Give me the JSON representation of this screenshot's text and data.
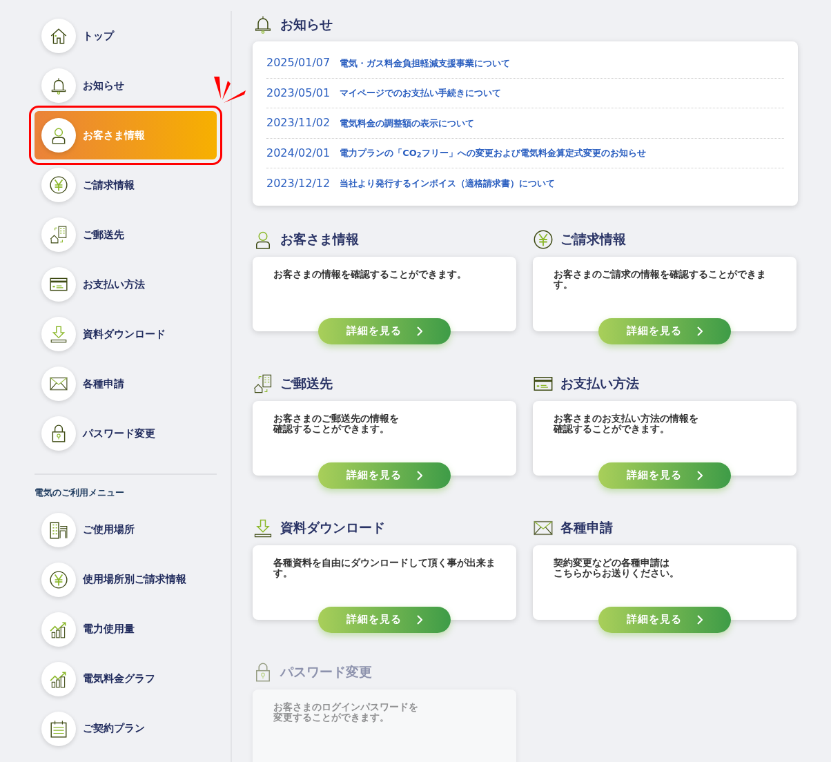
{
  "sidebar": {
    "main_items": [
      {
        "label": "トップ",
        "selected": false,
        "annotated": false
      },
      {
        "label": "お知らせ",
        "selected": false,
        "annotated": false
      },
      {
        "label": "お客さま情報",
        "selected": true,
        "annotated": true
      },
      {
        "label": "ご請求情報",
        "selected": false,
        "annotated": false
      },
      {
        "label": "ご郵送先",
        "selected": false,
        "annotated": false
      },
      {
        "label": "お支払い方法",
        "selected": false,
        "annotated": false
      },
      {
        "label": "資料ダウンロード",
        "selected": false,
        "annotated": false
      },
      {
        "label": "各種申請",
        "selected": false,
        "annotated": false
      },
      {
        "label": "パスワード変更",
        "selected": false,
        "annotated": false
      }
    ],
    "usage_menu": {
      "title": "電気のご利用メニュー",
      "items": [
        {
          "label": "ご使用場所",
          "selected": false,
          "annotated": false
        },
        {
          "label": "使用場所別ご請求情報",
          "selected": false,
          "annotated": false
        },
        {
          "label": "電力使用量",
          "selected": false,
          "annotated": false
        },
        {
          "label": "電気料金グラフ",
          "selected": false,
          "annotated": false
        },
        {
          "label": "ご契約プラン",
          "selected": false,
          "annotated": false
        }
      ]
    }
  },
  "notices": {
    "title": "お知らせ",
    "items": [
      {
        "date": "2025/01/07",
        "title": "電気・ガス料金負担軽減支援事業について"
      },
      {
        "date": "2023/05/01",
        "title": "マイページでのお支払い手続きについて"
      },
      {
        "date": "2023/11/02",
        "title": "電気料金の調整額の表示について"
      },
      {
        "date": "2024/02/01",
        "title": "電力プランの「CO$_{2}$フリー」への変更および電気料金算定式変更のお知らせ"
      },
      {
        "date": "2023/12/12",
        "title": "当社より発行するインボイス（適格請求書）について"
      }
    ]
  },
  "sections": [
    {
      "title": "お客さま情報",
      "description": [
        "お客さまの情報を確認することができます。"
      ],
      "button": "詳細を見る",
      "faded": false
    },
    {
      "title": "ご請求情報",
      "description": [
        "お客さまのご請求の情報を確認することができます。"
      ],
      "button": "詳細を見る",
      "faded": false
    },
    {
      "title": "ご郵送先",
      "description": [
        "お客さまのご郵送先の情報を",
        "確認することができます。"
      ],
      "button": "詳細を見る",
      "faded": false
    },
    {
      "title": "お支払い方法",
      "description": [
        "お客さまのお支払い方法の情報を",
        "確認することができます。"
      ],
      "button": "詳細を見る",
      "faded": false
    },
    {
      "title": "資料ダウンロード",
      "description": [
        "各種資料を自由にダウンロードして頂く事が出来ます。"
      ],
      "button": "詳細を見る",
      "faded": false
    },
    {
      "title": "各種申請",
      "description": [
        "契約変更などの各種申請は",
        "こちらからお送りください。"
      ],
      "button": "詳細を見る",
      "faded": false
    },
    {
      "title": "パスワード変更",
      "description": [
        "お客さまのログインパスワードを",
        "変更することができます。"
      ],
      "faded": true
    }
  ]
}
